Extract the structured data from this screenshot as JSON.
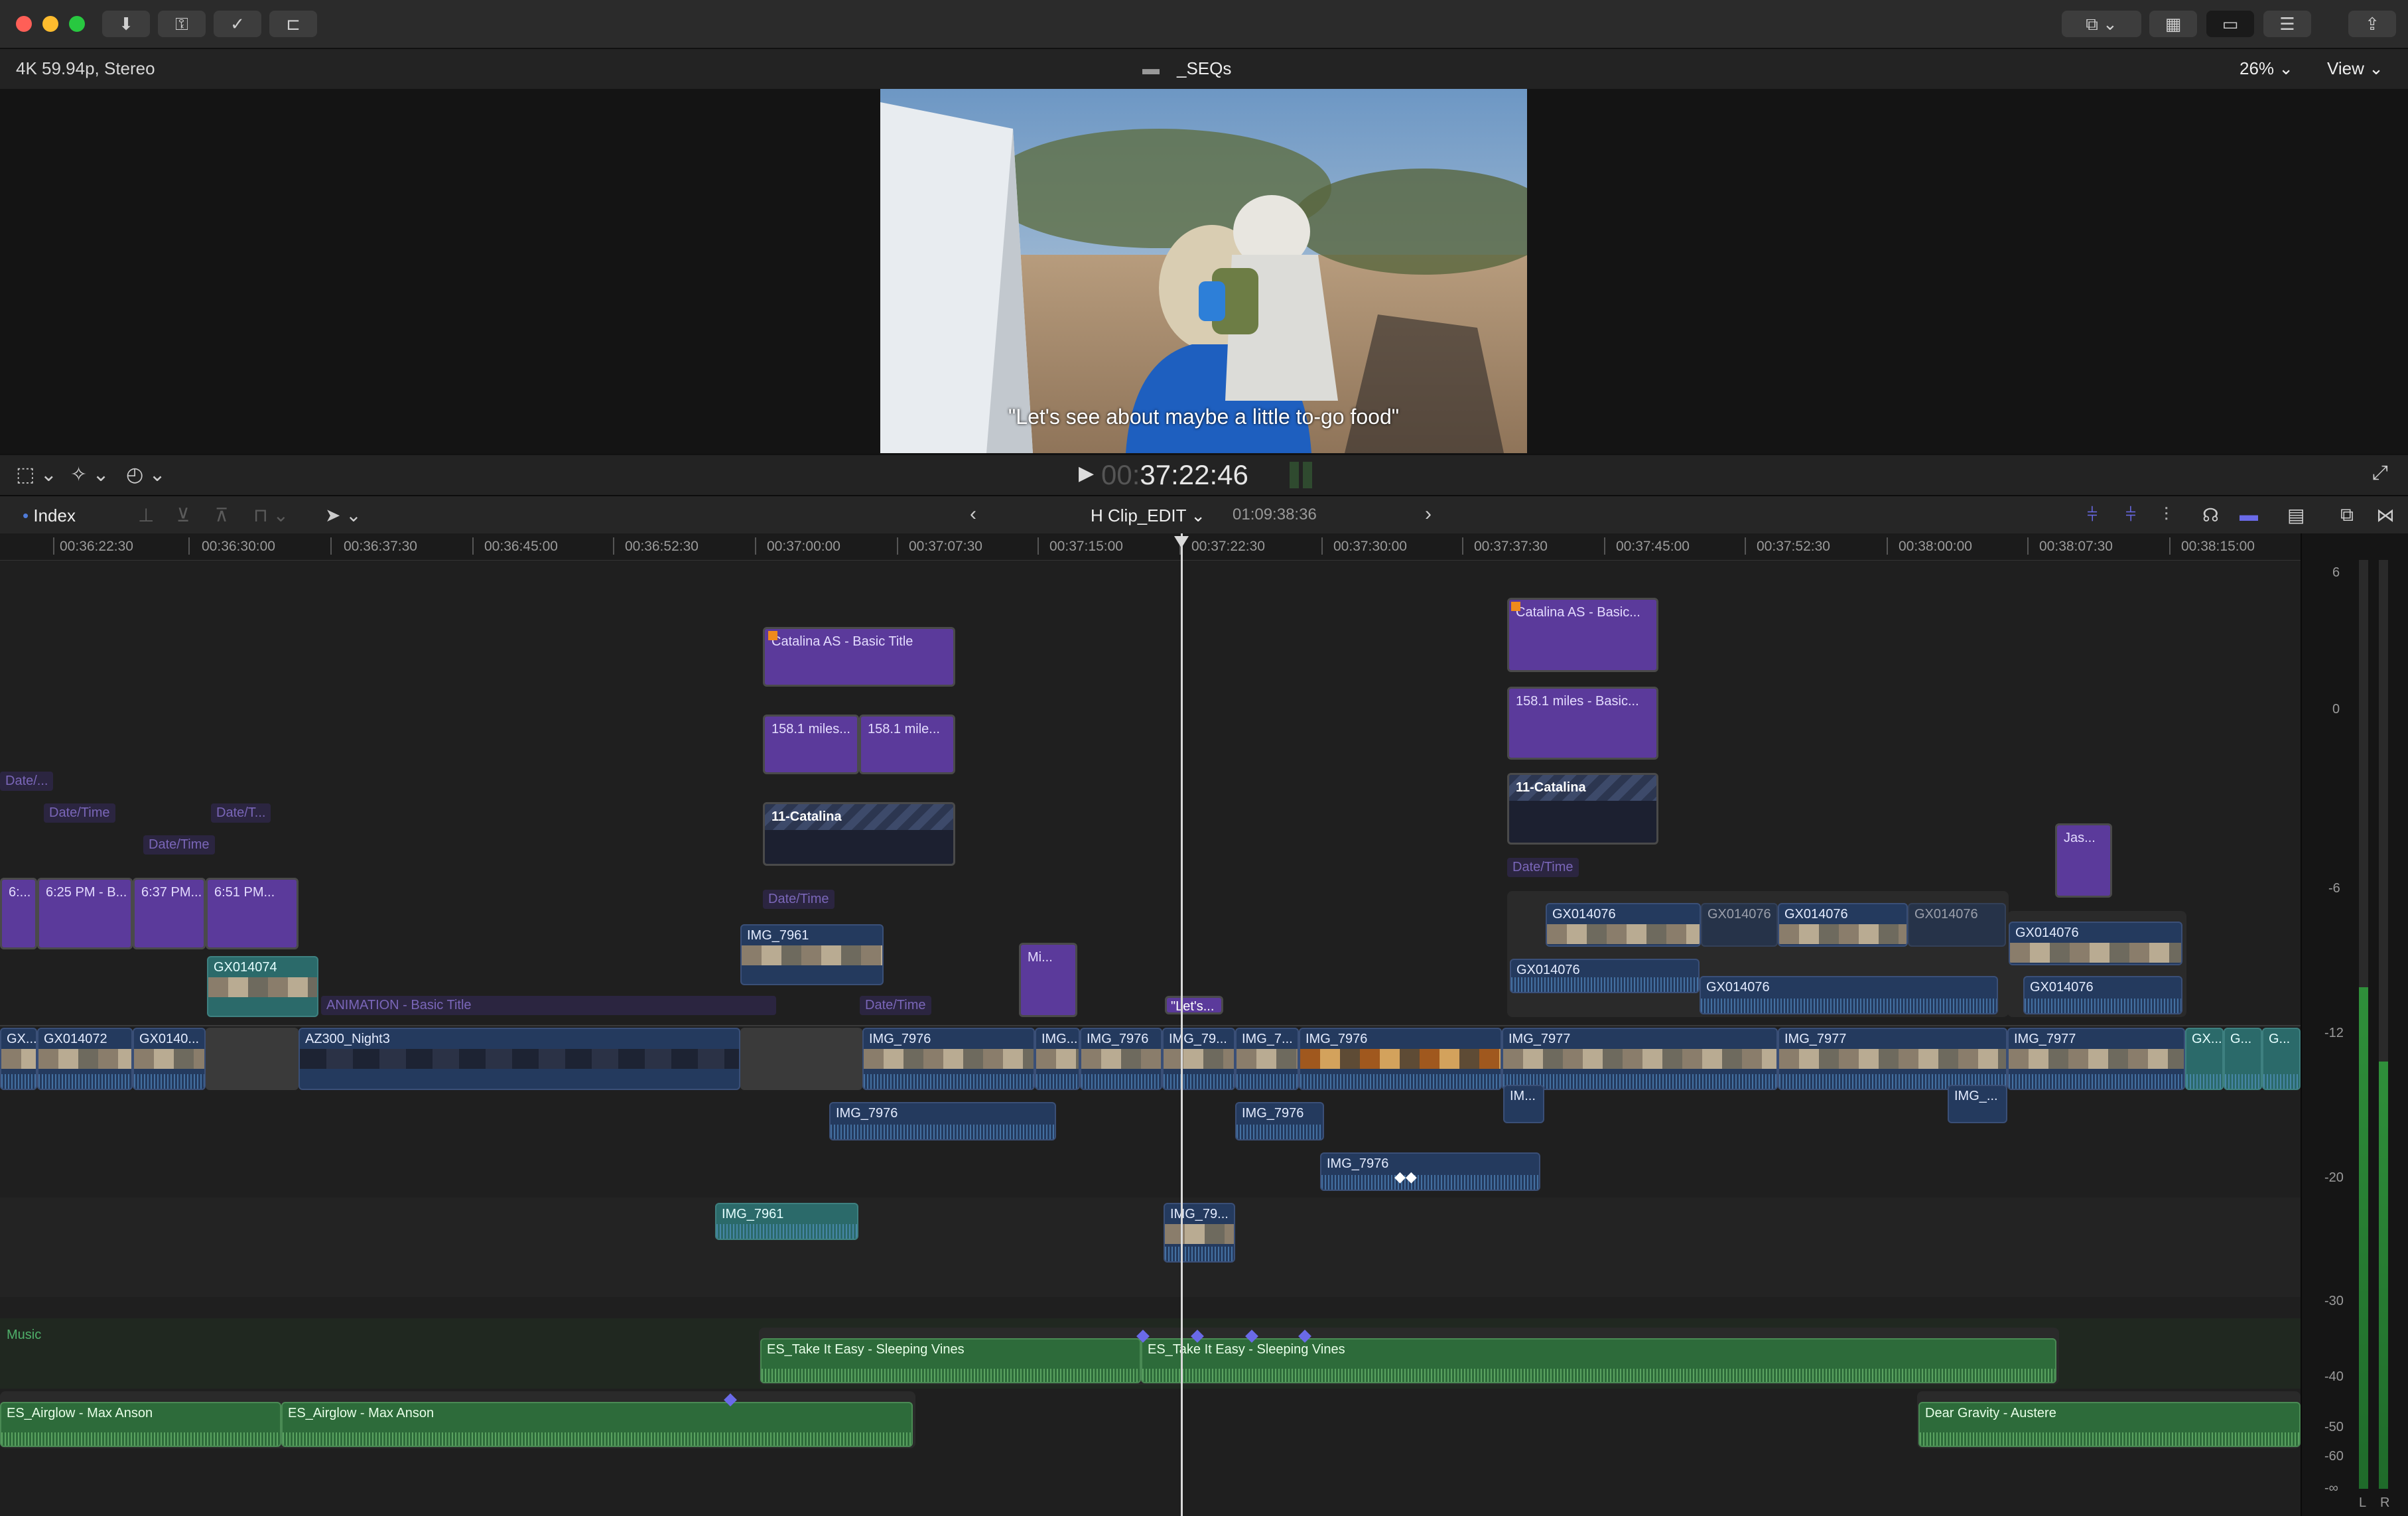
{
  "window": {
    "format_label": "4K 59.94p, Stereo",
    "project_name": "_SEQs",
    "zoom": "26%",
    "view_menu": "View"
  },
  "viewer": {
    "caption": "\"Let's see about maybe a little to-go food\"",
    "timecode_dim": "00:",
    "timecode": "37:22:46"
  },
  "timeline_header": {
    "index_label": "Index",
    "sequence_name": "H Clip_EDIT",
    "sequence_duration": "01:09:38:36"
  },
  "ruler": [
    "00:36:22:30",
    "00:36:30:00",
    "00:36:37:30",
    "00:36:45:00",
    "00:36:52:30",
    "00:37:00:00",
    "00:37:07:30",
    "00:37:15:00",
    "00:37:22:30",
    "00:37:30:00",
    "00:37:37:30",
    "00:37:45:00",
    "00:37:52:30",
    "00:38:00:00",
    "00:38:07:30",
    "00:38:15:00"
  ],
  "titles": {
    "catalina_1": "Catalina AS - Basic Title",
    "miles_1a": "158.1 miles...",
    "miles_1b": "158.1 mile...",
    "catalina_anim_1": "11-Catalina",
    "catalina_2": "Catalina AS - Basic...",
    "miles_2": "158.1 miles - Basic...",
    "catalina_anim_2": "11-Catalina",
    "jas": "Jas...",
    "mi": "Mi...",
    "lets": "\"Let's...",
    "t625": "6:25 PM - B...",
    "t637": "6:37 PM...",
    "t651": "6:51 PM...",
    "t6x": "6:...",
    "anim_basic": "ANIMATION - Basic Title"
  },
  "faint_labels": {
    "dt1": "Date/...",
    "dt2": "Date/Time",
    "dt3": "Date/T...",
    "dt4": "Date/Time",
    "dt5": "Date/Time",
    "dt6": "Date/Time",
    "dt7": "Date/Time"
  },
  "clips": {
    "gx014074": "GX014074",
    "img7961_upper": "IMG_7961",
    "gx_a": "GX014076",
    "gx_b": "GX014076",
    "gx_c": "GX014076",
    "gx_d": "GX014076",
    "gx_e": "GX014076",
    "gx_f": "GX014076",
    "gx_g": "GX014076",
    "gx_h": "GX014076",
    "p_gx": "GX...",
    "p_gx014072": "GX014072",
    "p_gx0140": "GX0140...",
    "p_az300": "AZ300_Night3",
    "p_img7976a": "IMG_7976",
    "p_img_a": "IMG...",
    "p_img7976b": "IMG_7976",
    "p_img79": "IMG_79...",
    "p_img7": "IMG_7...",
    "p_img7976c": "IMG_7976",
    "p_img7977a": "IMG_7977",
    "p_img7977b": "IMG_7977",
    "p_img7977c": "IMG_7977",
    "p_gx2": "GX...",
    "p_g1": "G...",
    "p_g2": "G...",
    "b_img7976a": "IMG_7976",
    "b_img7976b": "IMG_7976",
    "b_im": "IM...",
    "b_img_": "IMG_...",
    "b_img7976c": "IMG_7976",
    "c_img7961": "IMG_7961",
    "c_img79": "IMG_79..."
  },
  "audio": {
    "music_role": "Music",
    "take_easy_a": "ES_Take It Easy - Sleeping Vines",
    "take_easy_b": "ES_Take It Easy - Sleeping Vines",
    "airglow_a": "ES_Airglow - Max Anson",
    "airglow_b": "ES_Airglow - Max Anson",
    "dear_gravity": "Dear Gravity - Austere"
  },
  "meters": {
    "scale": [
      "6",
      "0",
      "-6",
      "-12",
      "-20",
      "-30",
      "-40",
      "-50",
      "-60",
      "-∞"
    ],
    "left": "L",
    "right": "R"
  }
}
